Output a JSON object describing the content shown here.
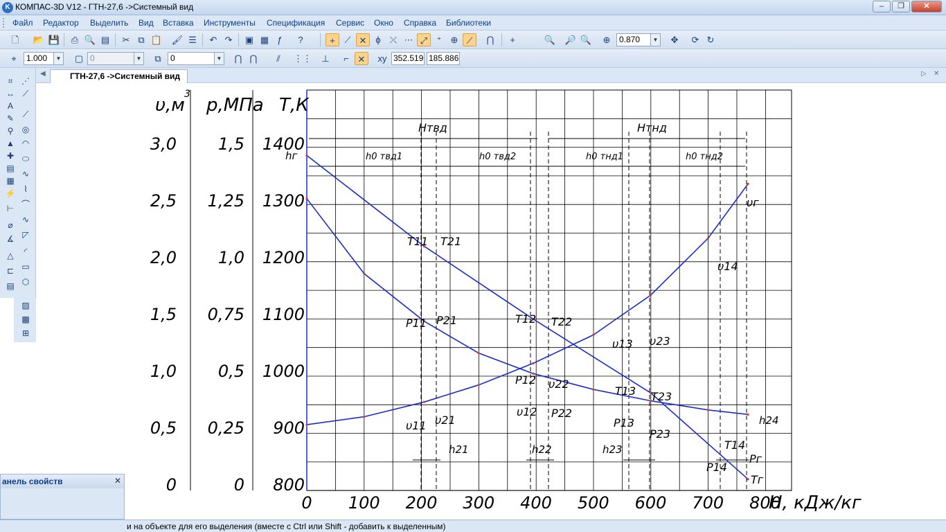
{
  "window": {
    "title": "КОМПАС-3D V12 - ГТН-27,6 ->Системный вид",
    "icon": "kompas-logo-icon"
  },
  "menu": [
    "Файл",
    "Редактор",
    "Выделить",
    "Вид",
    "Вставка",
    "Инструменты",
    "Спецификация",
    "Сервис",
    "Окно",
    "Справка",
    "Библиотеки"
  ],
  "toolbar1": {
    "zoom_value": "0.870"
  },
  "toolbar2": {
    "line_scale": "1.000",
    "layer_value": "0",
    "style_value": "0",
    "x_value": "352.519",
    "y_value": "185.886"
  },
  "doc_tab": {
    "label": "ГТН-27,6 ->Системный вид"
  },
  "props_panel": {
    "title": "анель свойств"
  },
  "status": {
    "text": "и на объекте для его выделения (вместе с Ctrl или Shift - добавить к выделенным)"
  },
  "chart_data": {
    "type": "line",
    "xlabel": "Н, кДж/кг",
    "x_ticks": [
      "0",
      "100",
      "200",
      "300",
      "400",
      "500",
      "600",
      "700",
      "800"
    ],
    "xlim": [
      0,
      800
    ],
    "axes": [
      {
        "label": "υ,м",
        "superscript": "3",
        "ticks": [
          "3,0",
          "2,5",
          "2,0",
          "1,5",
          "1,0",
          "0,5",
          "0"
        ],
        "range": [
          0,
          3.0
        ]
      },
      {
        "label": "p,МПа",
        "ticks": [
          "1,5",
          "1,25",
          "1,0",
          "0,75",
          "0,5",
          "0,25",
          "0"
        ],
        "range": [
          0,
          1.5
        ]
      },
      {
        "label": "Т,К",
        "ticks": [
          "1400",
          "1300",
          "1200",
          "1100",
          "1000",
          "900",
          "800"
        ],
        "range": [
          800,
          1400
        ]
      }
    ],
    "series": [
      {
        "name": "T",
        "axis": "Т,К",
        "x": [
          0,
          205,
          395,
          600,
          770
        ],
        "y": [
          1380,
          1220,
          1092,
          962,
          810
        ]
      },
      {
        "name": "p",
        "axis": "p,МПа",
        "x": [
          0,
          100,
          205,
          300,
          395,
          500,
          600,
          700,
          770
        ],
        "y": [
          1.26,
          0.93,
          0.72,
          0.58,
          0.49,
          0.42,
          0.37,
          0.33,
          0.31
        ]
      },
      {
        "name": "υ",
        "axis": "υ,м",
        "x": [
          0,
          100,
          205,
          300,
          395,
          500,
          600,
          700,
          770
        ],
        "y": [
          0.53,
          0.6,
          0.73,
          0.88,
          1.07,
          1.32,
          1.67,
          2.17,
          2.65
        ]
      }
    ],
    "point_labels": {
      "T": [
        "T11",
        "T21",
        "T12",
        "T22",
        "T13",
        "T23",
        "T14",
        "Tг"
      ],
      "p": [
        "P11",
        "P21",
        "P12",
        "P22",
        "P13",
        "P23",
        "P14",
        "Pг"
      ],
      "v": [
        "υ11",
        "υ21",
        "υ12",
        "υ22",
        "υ13",
        "υ23",
        "υ14",
        "υг"
      ]
    },
    "interval_labels": [
      "Нтвд",
      "Нтнд",
      "h0 твд1",
      "h0 твд2",
      "h0 тнд1",
      "h0 тнд2",
      "h21",
      "h22",
      "h23",
      "h24",
      "hг"
    ],
    "grid": true,
    "legend": "none"
  }
}
